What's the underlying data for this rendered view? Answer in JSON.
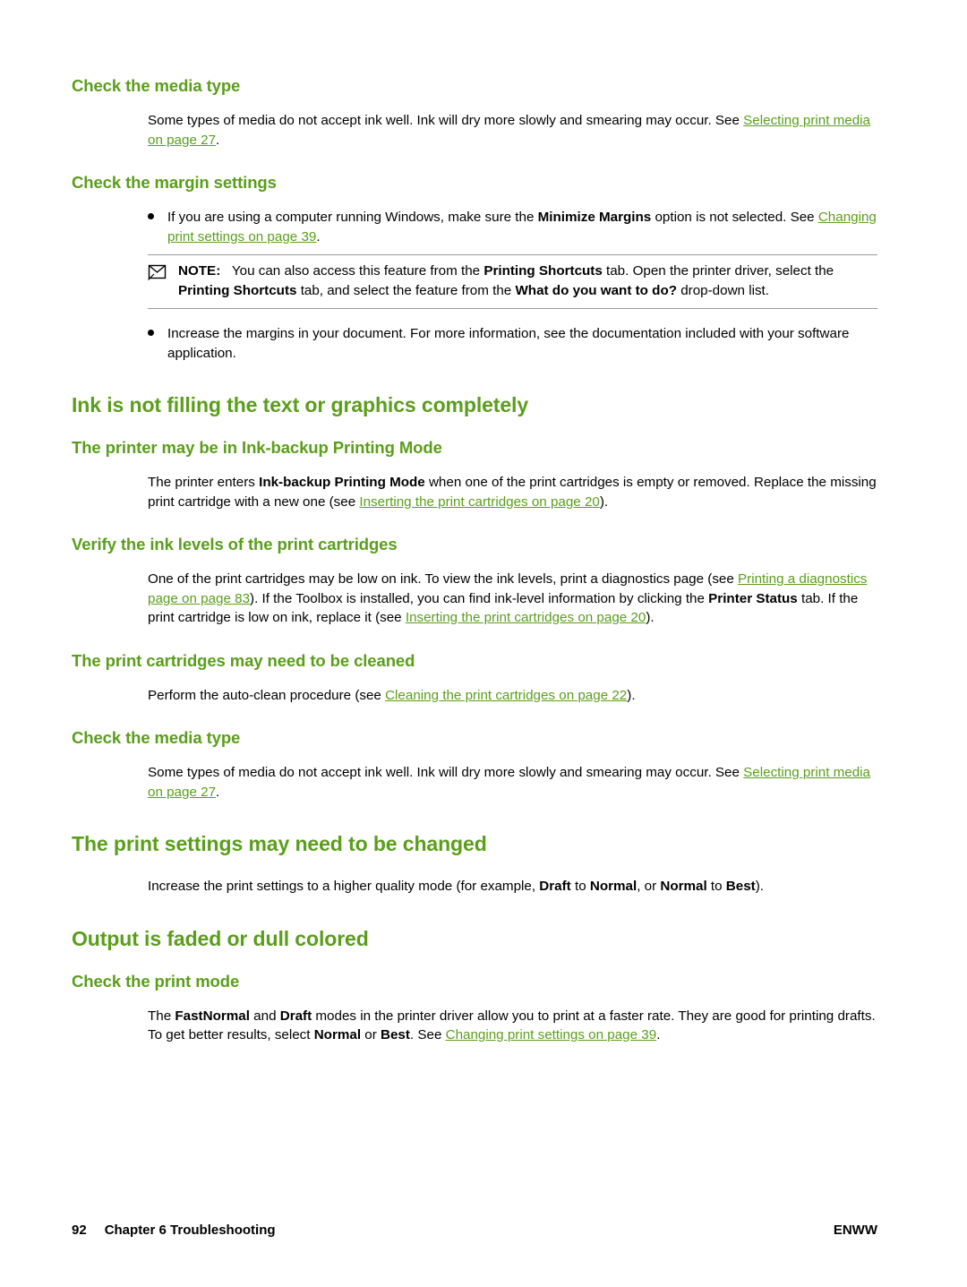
{
  "page": {
    "footer": {
      "page_number": "92",
      "chapter": "Chapter 6   Troubleshooting",
      "right": "ENWW"
    }
  },
  "sections": {
    "check_media_type_1": {
      "heading": "Check the media type",
      "para_a": "Some types of media do not accept ink well. Ink will dry more slowly and smearing may occur. See ",
      "link_a": "Selecting print media on page 27",
      "para_a_end": "."
    },
    "check_margin_settings": {
      "heading": "Check the margin settings",
      "bullet1_a": "If you are using a computer running Windows, make sure the ",
      "bullet1_b1": "Minimize Margins",
      "bullet1_b": " option is not selected. See ",
      "bullet1_link": "Changing print settings on page 39",
      "bullet1_end": ".",
      "note_label": "NOTE:",
      "note_a": "You can also access this feature from the ",
      "note_b1": "Printing Shortcuts",
      "note_b": " tab. Open the printer driver, select the ",
      "note_b2": "Printing Shortcuts",
      "note_c": " tab, and select the feature from the ",
      "note_b3": "What do you want to do?",
      "note_d": " drop-down list.",
      "bullet2": "Increase the margins in your document. For more information, see the documentation included with your software application."
    },
    "ink_not_filling": {
      "heading": "Ink is not filling the text or graphics completely",
      "sub1": {
        "heading": "The printer may be in Ink-backup Printing Mode",
        "para_a": "The printer enters ",
        "bold_a": "Ink-backup Printing Mode",
        "para_b": " when one of the print cartridges is empty or removed. Replace the missing print cartridge with a new one (see ",
        "link": "Inserting the print cartridges on page 20",
        "para_end": ")."
      },
      "sub2": {
        "heading": "Verify the ink levels of the print cartridges",
        "para_a": "One of the print cartridges may be low on ink. To view the ink levels, print a diagnostics page (see ",
        "link1": "Printing a diagnostics page on page 83",
        "para_b": "). If the Toolbox is installed, you can find ink-level information by clicking the ",
        "bold_a": "Printer Status",
        "para_c": " tab. If the print cartridge is low on ink, replace it (see ",
        "link2": "Inserting the print cartridges on page 20",
        "para_end": ")."
      },
      "sub3": {
        "heading": "The print cartridges may need to be cleaned",
        "para_a": "Perform the auto-clean procedure (see ",
        "link": "Cleaning the print cartridges on page 22",
        "para_end": ")."
      },
      "sub4": {
        "heading": "Check the media type",
        "para_a": "Some types of media do not accept ink well. Ink will dry more slowly and smearing may occur. See ",
        "link": "Selecting print media on page 27",
        "para_end": "."
      }
    },
    "print_settings_changed": {
      "heading": "The print settings may need to be changed",
      "para_a": "Increase the print settings to a higher quality mode (for example, ",
      "bold_a": "Draft",
      "para_b": " to ",
      "bold_b": "Normal",
      "para_c": ", or ",
      "bold_c": "Normal",
      "para_d": " to ",
      "bold_d": "Best",
      "para_end": ")."
    },
    "output_faded": {
      "heading": "Output is faded or dull colored",
      "sub1": {
        "heading": "Check the print mode",
        "para_a": "The ",
        "bold_a": "FastNormal",
        "para_b": " and ",
        "bold_b": "Draft",
        "para_c": " modes in the printer driver allow you to print at a faster rate. They are good for printing drafts. To get better results, select ",
        "bold_c": "Normal",
        "para_d": " or ",
        "bold_d": "Best",
        "para_e": ". See ",
        "link": "Changing print settings on page 39",
        "para_end": "."
      }
    }
  }
}
